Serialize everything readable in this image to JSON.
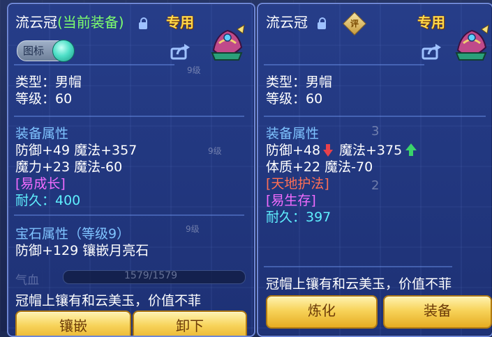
{
  "left_panel": {
    "title": "流云冠",
    "title_status": "(当前装备)",
    "exclusive": "专用",
    "toggle_label": "图标",
    "type_line": "类型：男帽",
    "level_line": "等级：60",
    "attr_header": "装备属性",
    "attr_line1": "防御+49 魔法+357",
    "attr_line2": "魔力+23 魔法-60",
    "special_effect": "[易成长]",
    "durability": "耐久：400",
    "gem_header": "宝石属性（等级9）",
    "gem_line": "防御+129 镶嵌月亮石",
    "hp_label": "气血",
    "hp_value": "1579/1579",
    "bg_level_1": "9级",
    "bg_level_2": "9级",
    "bg_level_3": "9级",
    "description": "冠帽上镶有和云美玉，价值不菲",
    "button_inlay": "镶嵌",
    "button_unequip": "卸下"
  },
  "right_panel": {
    "title": "流云冠",
    "rate_icon_label": "评",
    "exclusive": "专用",
    "type_line": "类型：男帽",
    "level_line": "等级：60",
    "attr_header": "装备属性",
    "attr_line1_a": "防御+48",
    "attr_line1_b": "魔法+375",
    "attr_line2": "体质+22 魔法-70",
    "special_skill": "[天地护法]",
    "special_effect": "[易生存]",
    "durability": "耐久：397",
    "description": "冠帽上镶有和云美玉，价值不菲",
    "button_refine": "炼化",
    "button_equip": "装备",
    "bg_count_1": "3",
    "bg_count_2": "2"
  },
  "colors": {
    "title_current": "#7dff6e",
    "section_header": "#7fc3ff",
    "durability": "#5ff0ff",
    "special_effect": "#f26cff",
    "special_skill": "#ff6f55",
    "exclusive": "#ffd94a",
    "arrow_down": "#e8414b",
    "arrow_up": "#3ad36a"
  },
  "icons": {
    "lock": "lock-icon",
    "share": "share-icon",
    "rate": "rate-icon",
    "item": "hat-item-icon",
    "arrow_down": "arrow-down-icon",
    "arrow_up": "arrow-up-icon"
  }
}
